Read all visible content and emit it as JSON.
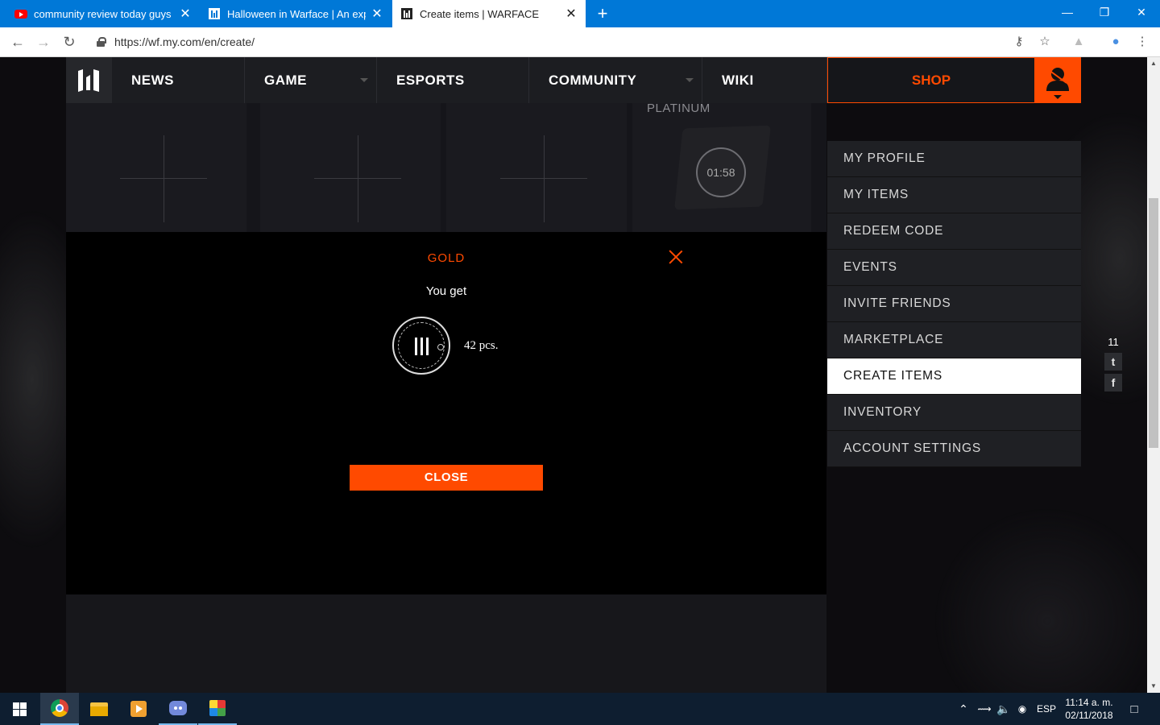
{
  "browser": {
    "tabs": [
      {
        "title": "community review today guys - Y",
        "favicon": "youtube-icon"
      },
      {
        "title": "Halloween in Warface | An explo",
        "favicon": "warface-icon"
      },
      {
        "title": "Create items | WARFACE",
        "favicon": "warface-icon",
        "active": true
      }
    ],
    "new_tab": "+",
    "url": "https://wf.my.com/en/create/",
    "window_controls": {
      "minimize": "—",
      "maximize": "❐",
      "close": "✕"
    }
  },
  "nav": {
    "items": [
      {
        "label": "NEWS",
        "dropdown": false
      },
      {
        "label": "GAME",
        "dropdown": true
      },
      {
        "label": "ESPORTS",
        "dropdown": false
      },
      {
        "label": "COMMUNITY",
        "dropdown": true
      },
      {
        "label": "WIKI",
        "dropdown": false
      }
    ],
    "shop": "SHOP",
    "accent": "#ff4a00"
  },
  "cards": {
    "platinum_label": "PLATINUM",
    "timer": "01:58"
  },
  "modal": {
    "title": "GOLD",
    "subtitle": "You get",
    "quantity": "42 pcs.",
    "close_button": "CLOSE"
  },
  "user_menu": {
    "items": [
      {
        "label": "MY PROFILE"
      },
      {
        "label": "MY ITEMS"
      },
      {
        "label": "REDEEM CODE"
      },
      {
        "label": "EVENTS"
      },
      {
        "label": "INVITE FRIENDS"
      },
      {
        "label": "MARKETPLACE"
      },
      {
        "label": "CREATE ITEMS",
        "active": true
      },
      {
        "label": "INVENTORY"
      },
      {
        "label": "ACCOUNT SETTINGS"
      }
    ]
  },
  "social": {
    "count": "11",
    "twitter": "t",
    "facebook": "f"
  },
  "taskbar": {
    "language": "ESP",
    "time": "11:14 a. m.",
    "date": "02/11/2018"
  }
}
